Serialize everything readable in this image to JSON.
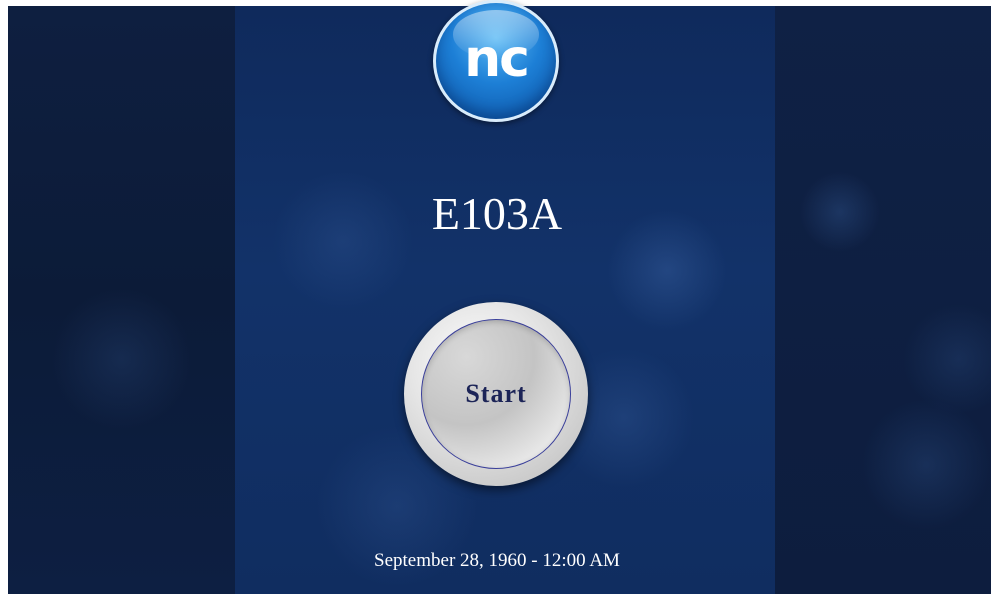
{
  "logo": {
    "text": "nc"
  },
  "room": {
    "name": "E103A"
  },
  "start_button": {
    "label": "Start"
  },
  "status": {
    "datetime": "September 28, 1960 - 12:00 AM"
  },
  "colors": {
    "background_dark": "#0d1f42",
    "panel_blue": "#123269",
    "logo_blue": "#1d7fd6",
    "button_silver": "#e6e6e6",
    "button_text": "#1c2457"
  },
  "icons": {
    "logo": "nc-logo-icon"
  }
}
